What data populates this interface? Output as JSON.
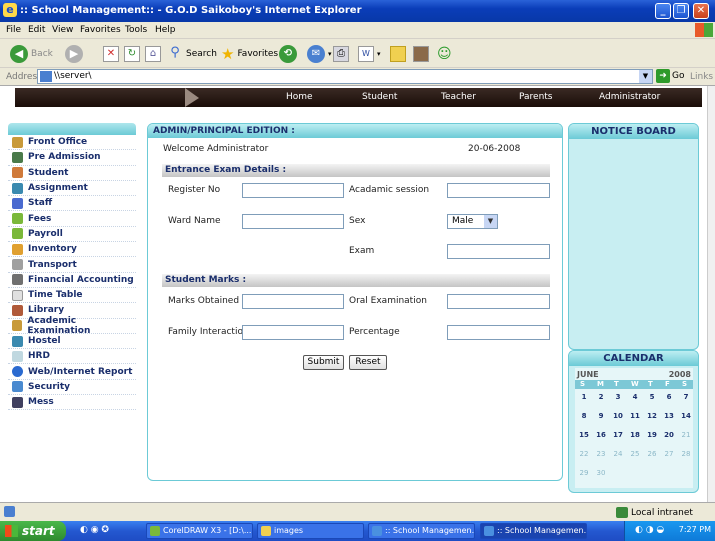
{
  "window": {
    "title": ":: School Management:: - G.O.D Saikoboy's Internet Explorer"
  },
  "menubar": [
    "File",
    "Edit",
    "View",
    "Favorites",
    "Tools",
    "Help"
  ],
  "toolbar": {
    "back": "Back",
    "search": "Search",
    "favorites": "Favorites"
  },
  "address": {
    "label": "Address",
    "value": "\\\\server\\",
    "go": "Go",
    "links": "Links"
  },
  "nav": [
    "Home",
    "Student",
    "Teacher",
    "Parents",
    "Administrator"
  ],
  "leftmenu": [
    "Front Office",
    "Pre Admission",
    "Student",
    "Assignment",
    "Staff",
    "Fees",
    "Payroll",
    "Inventory",
    "Transport",
    "Financial Accounting",
    "Time Table",
    "Library",
    "Academic Examination",
    "Hostel",
    "HRD",
    "Web/Internet Report",
    "Security",
    "Mess"
  ],
  "panel": {
    "title": "ADMIN/PRINCIPAL EDITION :",
    "welcome": "Welcome Administrator",
    "date": "20-06-2008",
    "entrance_header": "Entrance Exam Details :",
    "register_no": "Register No",
    "academic_session": "Acadamic session",
    "ward_name": "Ward Name",
    "sex": "Sex",
    "sex_value": "Male",
    "exam": "Exam",
    "marks_header": "Student Marks :",
    "marks_obtained": "Marks Obtained",
    "oral_exam": "Oral Examination",
    "family_interaction": "Family Interaction",
    "percentage": "Percentage",
    "submit": "Submit",
    "reset": "Reset"
  },
  "notice": {
    "title": "NOTICE BOARD"
  },
  "calendar": {
    "title": "CALENDAR",
    "month": "JUNE",
    "year": "2008",
    "weekdays": [
      "S",
      "M",
      "T",
      "W",
      "T",
      "F",
      "S"
    ],
    "weeks": [
      [
        "1",
        "2",
        "3",
        "4",
        "5",
        "6",
        "7"
      ],
      [
        "8",
        "9",
        "10",
        "11",
        "12",
        "13",
        "14"
      ],
      [
        "15",
        "16",
        "17",
        "18",
        "19",
        "20",
        "21"
      ],
      [
        "22",
        "23",
        "24",
        "25",
        "26",
        "27",
        "28"
      ],
      [
        "29",
        "30",
        "",
        "",
        "",
        "",
        ""
      ]
    ]
  },
  "status": {
    "zone": "Local intranet"
  },
  "taskbar": {
    "start": "start",
    "items": [
      "CorelDRAW X3 - [D:\\...",
      "images",
      ":: School Managemen...",
      ":: School Managemen..."
    ],
    "clock": "7:27 PM"
  }
}
